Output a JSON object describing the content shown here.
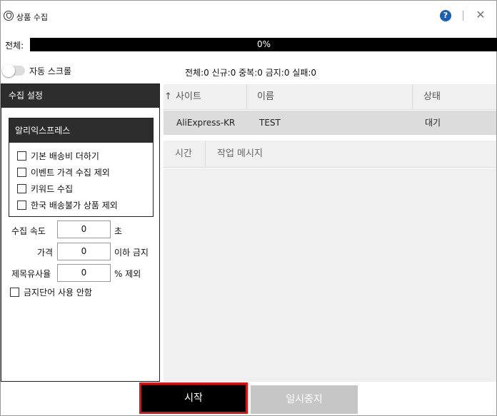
{
  "window": {
    "title": "상품 수집",
    "help_glyph": "?",
    "close_glyph": "✕",
    "icons": [
      "app-logo-icon",
      "help-icon",
      "close-icon"
    ]
  },
  "progress": {
    "label": "전체:",
    "value_text": "0%",
    "value": 0
  },
  "auto_scroll": {
    "label": "자동 스크롤",
    "enabled": false
  },
  "stats": {
    "text": "전체:0 신규:0 중복:0 금지:0 실패:0"
  },
  "settings": {
    "title": "수집 설정",
    "group_title": "알리익스프레스",
    "options": [
      {
        "label": "기본 배송비 더하기",
        "checked": false
      },
      {
        "label": "이벤트 가격 수집 제외",
        "checked": false
      },
      {
        "label": "키워드 수집",
        "checked": false
      },
      {
        "label": "한국 배송불가 상품 제외",
        "checked": false
      }
    ],
    "speed": {
      "label": "수집 속도",
      "value": "0",
      "unit": "초"
    },
    "price": {
      "label": "가격",
      "value": "0",
      "unit": "이하 금지"
    },
    "title_similarity": {
      "label": "제목유사율",
      "value": "0",
      "unit": "% 제외"
    },
    "banned_words": {
      "label": "금지단어 사용 안함",
      "checked": false
    }
  },
  "site_table": {
    "sort_icon": "↑",
    "columns": [
      "사이트",
      "이름",
      "상태"
    ],
    "rows": [
      {
        "site": "AliExpress-KR",
        "name": "TEST",
        "status": "대기"
      }
    ]
  },
  "log_table": {
    "columns": [
      "시간",
      "작업 메시지"
    ]
  },
  "buttons": {
    "start": "시작",
    "pause": "일시중지"
  },
  "colors": {
    "dark_header": "#2d2d2d",
    "start_border": "#e01010",
    "pause_disabled": "#c6c6c6",
    "help_blue": "#1a5fb4"
  }
}
